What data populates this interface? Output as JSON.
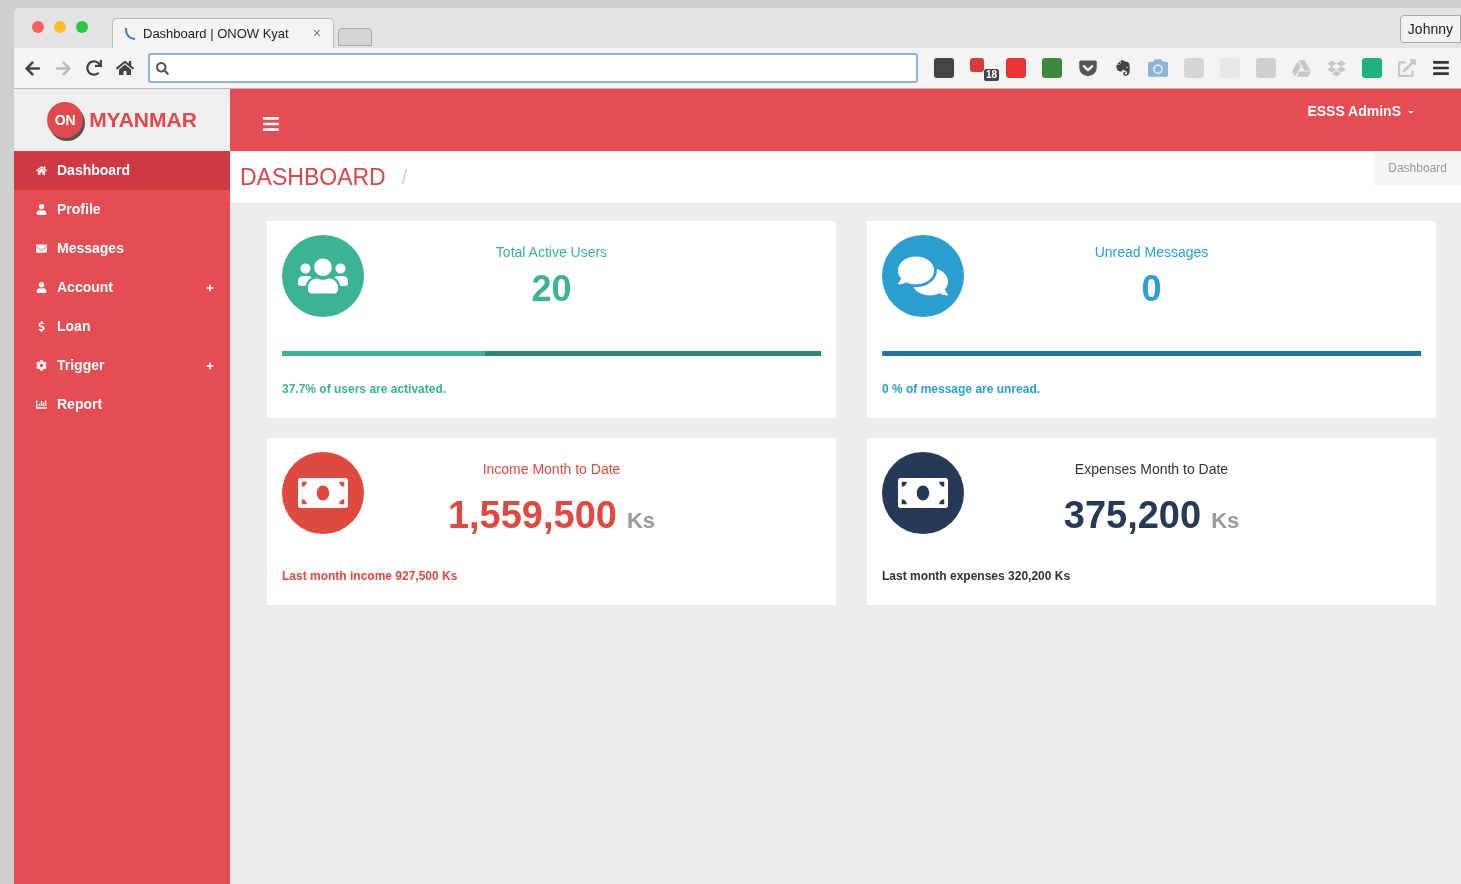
{
  "browser": {
    "tab_title": "Dashboard | ONOW Kyat",
    "tab_close": "×",
    "profile": "Johnny",
    "extension_badge": "18"
  },
  "brand": {
    "logo_text": "ON",
    "name": "MYANMAR"
  },
  "header": {
    "user_menu": "ESSS AdminS"
  },
  "sidebar": {
    "items": [
      {
        "label": "Dashboard",
        "selected": true,
        "expandable": false
      },
      {
        "label": "Profile",
        "selected": false,
        "expandable": false
      },
      {
        "label": "Messages",
        "selected": false,
        "expandable": false
      },
      {
        "label": "Account",
        "selected": false,
        "expandable": true
      },
      {
        "label": "Loan",
        "selected": false,
        "expandable": false
      },
      {
        "label": "Trigger",
        "selected": false,
        "expandable": true
      },
      {
        "label": "Report",
        "selected": false,
        "expandable": false
      }
    ]
  },
  "page": {
    "title": "DASHBOARD",
    "separator": "/",
    "breadcrumb": "Dashboard"
  },
  "cards": [
    {
      "kind": "progress",
      "color": "#3bb394",
      "title": "Total Active Users",
      "value": "20",
      "level": 0.377,
      "footer": "37.7% of users are activated."
    },
    {
      "kind": "progress",
      "color": "#2a9fd0",
      "title": "Unread Messages",
      "value": "0",
      "level": 0,
      "footer": "0 % of message are unread."
    },
    {
      "kind": "money",
      "color": "#e0493f",
      "title": "Income Month to Date",
      "value": "1,559,500",
      "unit": "Ks",
      "footer": "Last month income 927,500 Ks"
    },
    {
      "kind": "money",
      "color": "#263a55",
      "title": "Expenses Month to Date",
      "value": "375,200",
      "unit": "Ks",
      "footer": "Last month expenses 320,200 Ks"
    }
  ]
}
